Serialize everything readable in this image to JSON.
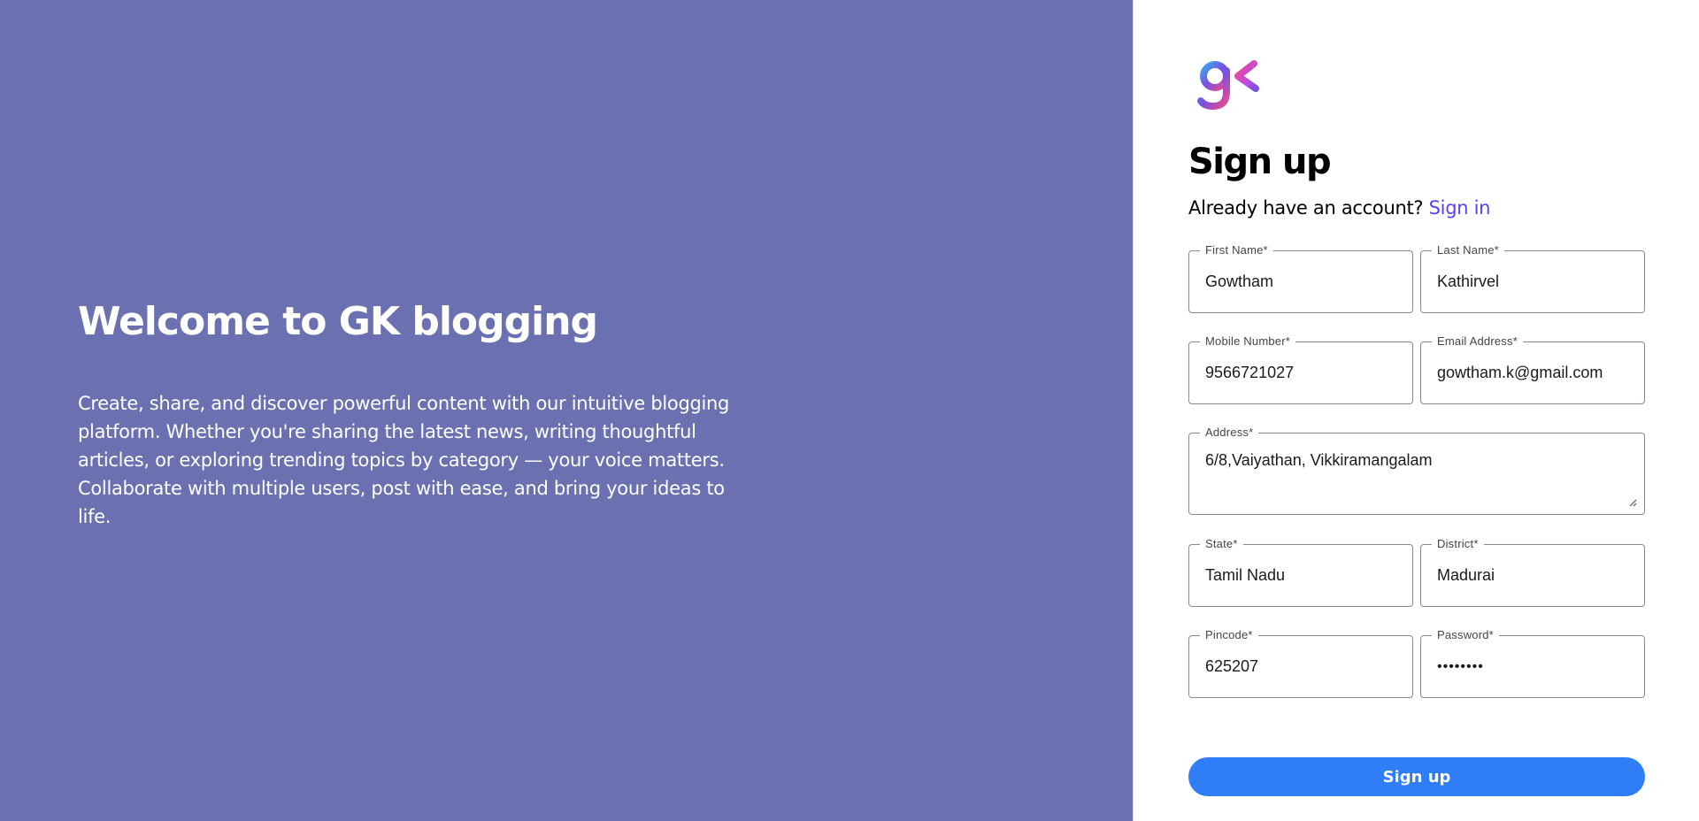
{
  "hero": {
    "title": "Welcome to GK blogging",
    "description": "Create, share, and discover powerful content with our intuitive blogging platform. Whether you're sharing the latest news, writing thoughtful articles, or exploring trending topics by category — your voice matters. Collaborate with multiple users, post with ease, and bring your ideas to life."
  },
  "form": {
    "title": "Sign up",
    "account_prompt": "Already have an account?",
    "signin_link": "Sign in",
    "fields": {
      "first_name": {
        "label": "First Name*",
        "value": "Gowtham"
      },
      "last_name": {
        "label": "Last Name*",
        "value": "Kathirvel"
      },
      "mobile": {
        "label": "Mobile Number*",
        "value": "9566721027"
      },
      "email": {
        "label": "Email Address*",
        "value": "gowtham.k@gmail.com"
      },
      "address": {
        "label": "Address*",
        "value": "6/8,Vaiyathan, Vikkiramangalam"
      },
      "state": {
        "label": "State*",
        "value": "Tamil Nadu"
      },
      "district": {
        "label": "District*",
        "value": "Madurai"
      },
      "pincode": {
        "label": "Pincode*",
        "value": "625207"
      },
      "password": {
        "label": "Password*",
        "value": "••••••••"
      }
    },
    "submit_label": "Sign up"
  },
  "colors": {
    "left_panel_bg": "#6b71b0",
    "link": "#5b3ff0",
    "button": "#2f7ef7"
  },
  "icons": {
    "logo": "gk-logo-icon",
    "resize": "resize-handle-icon"
  }
}
